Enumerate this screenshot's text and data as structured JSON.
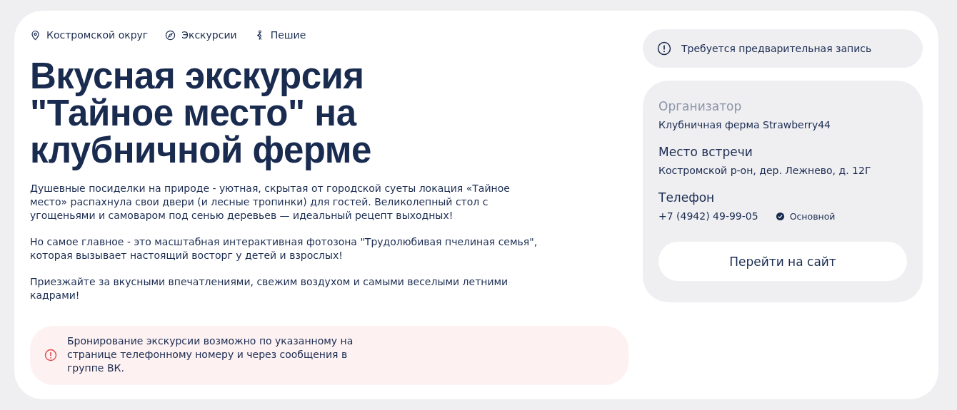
{
  "tags": [
    {
      "kind": "location",
      "label": "Костромской округ"
    },
    {
      "kind": "compass",
      "label": "Экскурсии"
    },
    {
      "kind": "walker",
      "label": "Пешие"
    }
  ],
  "title": "Вкусная экскурсия \"Тайное место\" на клубничной ферме",
  "description": [
    "Душевные посиделки на природе - уютная, скрытая от городской суеты локация «Тайное место» распахнула свои двери (и лесные тропинки) для гостей. Великолепный стол с угощеньями и самоваром под сенью деревьев — идеальный рецепт выходных!",
    "Но самое главное - это масштабная интерактивная фотозона \"Трудолюбивая пчелиная семья\", которая вызывает настоящий восторг у детей и взрослых!",
    "Приезжайте за вкусными впечатлениями, свежим воздухом и самыми веселыми летними кадрами!"
  ],
  "notice": "Бронирование экскурсии возможно по указанному на странице телефонному номеру и через сообщения в группе ВК.",
  "booking_badge": "Требуется предварительная запись",
  "info": {
    "organizer_label": "Организатор",
    "organizer": "Клубничная ферма Strawberry44",
    "meeting_label": "Место встречи",
    "meeting": "Костромской р-он, дер. Лежнево, д. 12Г",
    "phone_label": "Телефон",
    "phone": "+7 (4942) 49-99-05",
    "phone_main": true,
    "phone_main_label": "Основной",
    "button": "Перейти на сайт"
  }
}
